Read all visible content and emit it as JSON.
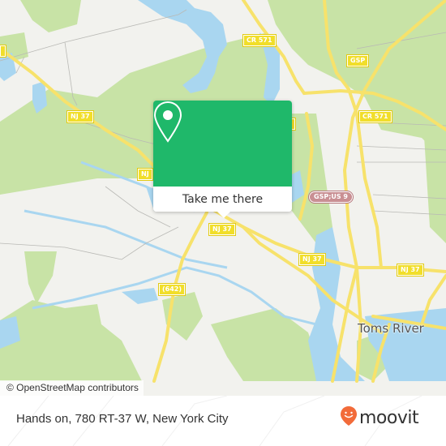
{
  "map": {
    "labels": {
      "city": "Toms River",
      "shields": [
        {
          "id": "cr571-a",
          "text": "CR 571"
        },
        {
          "id": "gsp",
          "text": "GSP"
        },
        {
          "id": "nj37-a",
          "text": "NJ 37"
        },
        {
          "id": "cr571-b",
          "text": "CR 571"
        },
        {
          "id": "nj37-b",
          "text": "NJ"
        },
        {
          "id": "nj37-c",
          "text": "NJ 37"
        },
        {
          "id": "nj37-d",
          "text": "NJ 37"
        },
        {
          "id": "nj37-e",
          "text": "NJ 37"
        },
        {
          "id": "cr642",
          "text": "(642)"
        },
        {
          "id": "nj37-left",
          "text": ""
        }
      ],
      "gsp_us9": "GSP;US 9"
    },
    "attribution": "© OpenStreetMap contributors",
    "colors": {
      "land": "#f2f2ee",
      "forest": "#c8e3a6",
      "water": "#a9d6f0",
      "road": "#f7e26b",
      "accent": "#1fb86a"
    }
  },
  "popup": {
    "icon": "location-pin-icon",
    "button_label": "Take me there"
  },
  "footer": {
    "address": "Hands on, 780 RT-37 W, New York City",
    "brand": "moovit",
    "brand_color": "#f26b3a"
  }
}
